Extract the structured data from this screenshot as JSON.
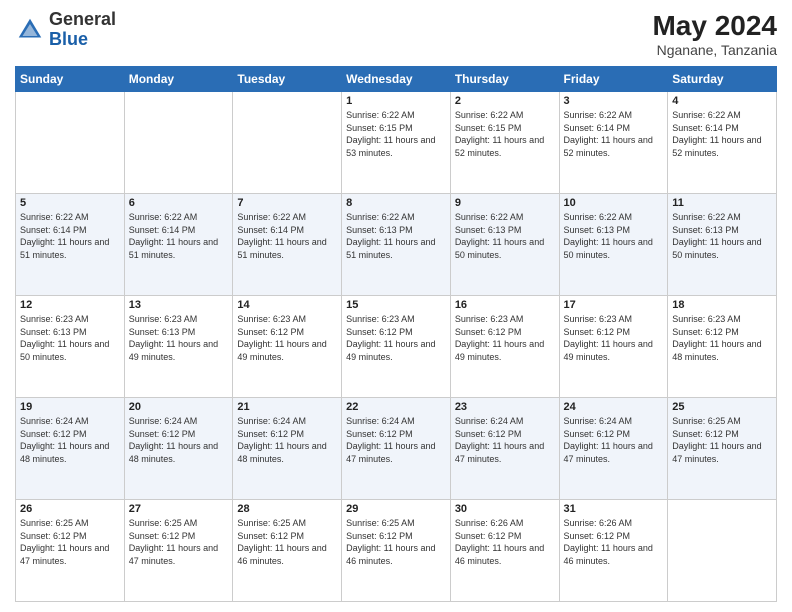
{
  "header": {
    "logo": {
      "general": "General",
      "blue": "Blue"
    },
    "month_year": "May 2024",
    "location": "Nganane, Tanzania"
  },
  "columns": [
    "Sunday",
    "Monday",
    "Tuesday",
    "Wednesday",
    "Thursday",
    "Friday",
    "Saturday"
  ],
  "weeks": [
    [
      {
        "day": "",
        "sunrise": "",
        "sunset": "",
        "daylight": ""
      },
      {
        "day": "",
        "sunrise": "",
        "sunset": "",
        "daylight": ""
      },
      {
        "day": "",
        "sunrise": "",
        "sunset": "",
        "daylight": ""
      },
      {
        "day": "1",
        "sunrise": "Sunrise: 6:22 AM",
        "sunset": "Sunset: 6:15 PM",
        "daylight": "Daylight: 11 hours and 53 minutes."
      },
      {
        "day": "2",
        "sunrise": "Sunrise: 6:22 AM",
        "sunset": "Sunset: 6:15 PM",
        "daylight": "Daylight: 11 hours and 52 minutes."
      },
      {
        "day": "3",
        "sunrise": "Sunrise: 6:22 AM",
        "sunset": "Sunset: 6:14 PM",
        "daylight": "Daylight: 11 hours and 52 minutes."
      },
      {
        "day": "4",
        "sunrise": "Sunrise: 6:22 AM",
        "sunset": "Sunset: 6:14 PM",
        "daylight": "Daylight: 11 hours and 52 minutes."
      }
    ],
    [
      {
        "day": "5",
        "sunrise": "Sunrise: 6:22 AM",
        "sunset": "Sunset: 6:14 PM",
        "daylight": "Daylight: 11 hours and 51 minutes."
      },
      {
        "day": "6",
        "sunrise": "Sunrise: 6:22 AM",
        "sunset": "Sunset: 6:14 PM",
        "daylight": "Daylight: 11 hours and 51 minutes."
      },
      {
        "day": "7",
        "sunrise": "Sunrise: 6:22 AM",
        "sunset": "Sunset: 6:14 PM",
        "daylight": "Daylight: 11 hours and 51 minutes."
      },
      {
        "day": "8",
        "sunrise": "Sunrise: 6:22 AM",
        "sunset": "Sunset: 6:13 PM",
        "daylight": "Daylight: 11 hours and 51 minutes."
      },
      {
        "day": "9",
        "sunrise": "Sunrise: 6:22 AM",
        "sunset": "Sunset: 6:13 PM",
        "daylight": "Daylight: 11 hours and 50 minutes."
      },
      {
        "day": "10",
        "sunrise": "Sunrise: 6:22 AM",
        "sunset": "Sunset: 6:13 PM",
        "daylight": "Daylight: 11 hours and 50 minutes."
      },
      {
        "day": "11",
        "sunrise": "Sunrise: 6:22 AM",
        "sunset": "Sunset: 6:13 PM",
        "daylight": "Daylight: 11 hours and 50 minutes."
      }
    ],
    [
      {
        "day": "12",
        "sunrise": "Sunrise: 6:23 AM",
        "sunset": "Sunset: 6:13 PM",
        "daylight": "Daylight: 11 hours and 50 minutes."
      },
      {
        "day": "13",
        "sunrise": "Sunrise: 6:23 AM",
        "sunset": "Sunset: 6:13 PM",
        "daylight": "Daylight: 11 hours and 49 minutes."
      },
      {
        "day": "14",
        "sunrise": "Sunrise: 6:23 AM",
        "sunset": "Sunset: 6:12 PM",
        "daylight": "Daylight: 11 hours and 49 minutes."
      },
      {
        "day": "15",
        "sunrise": "Sunrise: 6:23 AM",
        "sunset": "Sunset: 6:12 PM",
        "daylight": "Daylight: 11 hours and 49 minutes."
      },
      {
        "day": "16",
        "sunrise": "Sunrise: 6:23 AM",
        "sunset": "Sunset: 6:12 PM",
        "daylight": "Daylight: 11 hours and 49 minutes."
      },
      {
        "day": "17",
        "sunrise": "Sunrise: 6:23 AM",
        "sunset": "Sunset: 6:12 PM",
        "daylight": "Daylight: 11 hours and 49 minutes."
      },
      {
        "day": "18",
        "sunrise": "Sunrise: 6:23 AM",
        "sunset": "Sunset: 6:12 PM",
        "daylight": "Daylight: 11 hours and 48 minutes."
      }
    ],
    [
      {
        "day": "19",
        "sunrise": "Sunrise: 6:24 AM",
        "sunset": "Sunset: 6:12 PM",
        "daylight": "Daylight: 11 hours and 48 minutes."
      },
      {
        "day": "20",
        "sunrise": "Sunrise: 6:24 AM",
        "sunset": "Sunset: 6:12 PM",
        "daylight": "Daylight: 11 hours and 48 minutes."
      },
      {
        "day": "21",
        "sunrise": "Sunrise: 6:24 AM",
        "sunset": "Sunset: 6:12 PM",
        "daylight": "Daylight: 11 hours and 48 minutes."
      },
      {
        "day": "22",
        "sunrise": "Sunrise: 6:24 AM",
        "sunset": "Sunset: 6:12 PM",
        "daylight": "Daylight: 11 hours and 47 minutes."
      },
      {
        "day": "23",
        "sunrise": "Sunrise: 6:24 AM",
        "sunset": "Sunset: 6:12 PM",
        "daylight": "Daylight: 11 hours and 47 minutes."
      },
      {
        "day": "24",
        "sunrise": "Sunrise: 6:24 AM",
        "sunset": "Sunset: 6:12 PM",
        "daylight": "Daylight: 11 hours and 47 minutes."
      },
      {
        "day": "25",
        "sunrise": "Sunrise: 6:25 AM",
        "sunset": "Sunset: 6:12 PM",
        "daylight": "Daylight: 11 hours and 47 minutes."
      }
    ],
    [
      {
        "day": "26",
        "sunrise": "Sunrise: 6:25 AM",
        "sunset": "Sunset: 6:12 PM",
        "daylight": "Daylight: 11 hours and 47 minutes."
      },
      {
        "day": "27",
        "sunrise": "Sunrise: 6:25 AM",
        "sunset": "Sunset: 6:12 PM",
        "daylight": "Daylight: 11 hours and 47 minutes."
      },
      {
        "day": "28",
        "sunrise": "Sunrise: 6:25 AM",
        "sunset": "Sunset: 6:12 PM",
        "daylight": "Daylight: 11 hours and 46 minutes."
      },
      {
        "day": "29",
        "sunrise": "Sunrise: 6:25 AM",
        "sunset": "Sunset: 6:12 PM",
        "daylight": "Daylight: 11 hours and 46 minutes."
      },
      {
        "day": "30",
        "sunrise": "Sunrise: 6:26 AM",
        "sunset": "Sunset: 6:12 PM",
        "daylight": "Daylight: 11 hours and 46 minutes."
      },
      {
        "day": "31",
        "sunrise": "Sunrise: 6:26 AM",
        "sunset": "Sunset: 6:12 PM",
        "daylight": "Daylight: 11 hours and 46 minutes."
      },
      {
        "day": "",
        "sunrise": "",
        "sunset": "",
        "daylight": ""
      }
    ]
  ]
}
